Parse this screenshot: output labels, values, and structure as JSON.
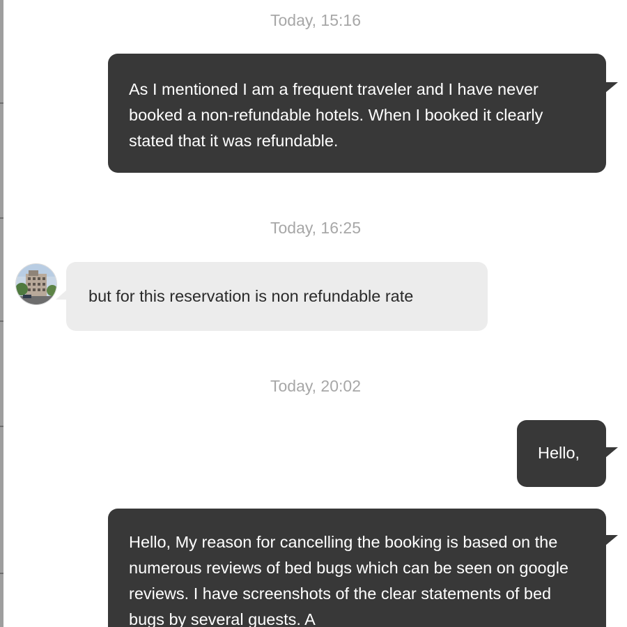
{
  "conversation": {
    "messages": [
      {
        "kind": "timestamp",
        "text": "Today, 15:16"
      },
      {
        "kind": "outgoing",
        "text": "As I mentioned I am a frequent traveler and I have never booked a non-refundable hotels. When I booked it clearly stated that it was refundable."
      },
      {
        "kind": "timestamp",
        "text": "Today, 16:25"
      },
      {
        "kind": "incoming",
        "text": "but for this reservation is non refundable rate"
      },
      {
        "kind": "timestamp",
        "text": "Today, 20:02"
      },
      {
        "kind": "outgoing",
        "text": "Hello,"
      },
      {
        "kind": "outgoing",
        "text": "Hello, My reason for cancelling the booking is based on the numerous reviews of bed bugs which can be seen on google reviews. I have screenshots of the clear statements of bed bugs by several guests. A"
      }
    ]
  },
  "theme": {
    "outgoing_bubble": "#383838",
    "incoming_bubble": "#ececec",
    "timestamp_text": "#a7a7a7"
  }
}
